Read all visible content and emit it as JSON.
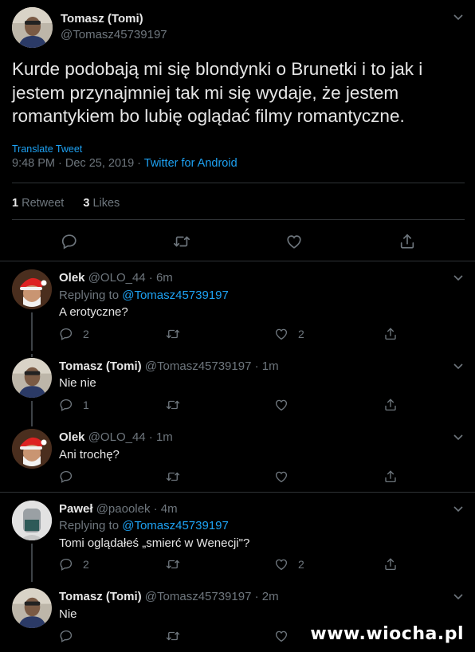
{
  "tweet": {
    "display_name": "Tomasz (Tomi)",
    "handle": "@Tomasz45739197",
    "text_line1": "Kurde podobają mi się blondynki o Brunetki i to jak i",
    "text_line2": "jestem przynajmniej tak mi się wydaje, że jestem",
    "text_line3": "romantykiem bo lubię oglądać filmy romantyczne.",
    "translate_label": "Translate Tweet",
    "timestamp": "9:48 PM · Dec 25, 2019 · ",
    "source": "Twitter for Android",
    "retweets_count": "1",
    "retweets_label": "Retweet",
    "likes_count": "3",
    "likes_label": "Likes"
  },
  "replies": [
    {
      "name": "Olek",
      "meta": "@OLO_44 · 6m",
      "replying_prefix": "Replying to ",
      "replying_to": "@Tomasz45739197",
      "text": "A erotyczne?",
      "reply_count": "2",
      "like_count": "2"
    },
    {
      "name": "Tomasz (Tomi)",
      "meta": "@Tomasz45739197 · 1m",
      "text": "Nie nie",
      "reply_count": "1",
      "like_count": ""
    },
    {
      "name": "Olek",
      "meta": "@OLO_44 · 1m",
      "text": "Ani trochę?",
      "reply_count": "",
      "like_count": ""
    },
    {
      "name": "Paweł",
      "meta": "@paoolek · 4m",
      "replying_prefix": "Replying to ",
      "replying_to": "@Tomasz45739197",
      "text": "Tomi oglądałeś „smierć w Wenecji\"?",
      "reply_count": "2",
      "like_count": "2"
    },
    {
      "name": "Tomasz (Tomi)",
      "meta": "@Tomasz45739197 · 2m",
      "text": "Nie",
      "reply_count": "",
      "like_count": ""
    }
  ],
  "icons": {
    "reply": "reply-icon",
    "retweet": "retweet-icon",
    "like": "heart-icon",
    "share": "share-icon",
    "more": "chevron-down-icon"
  },
  "watermark": "www.wiocha.pl",
  "colors": {
    "background": "#000000",
    "accent": "#1da1f2",
    "muted": "#6e767d",
    "divider": "#2f3336"
  }
}
